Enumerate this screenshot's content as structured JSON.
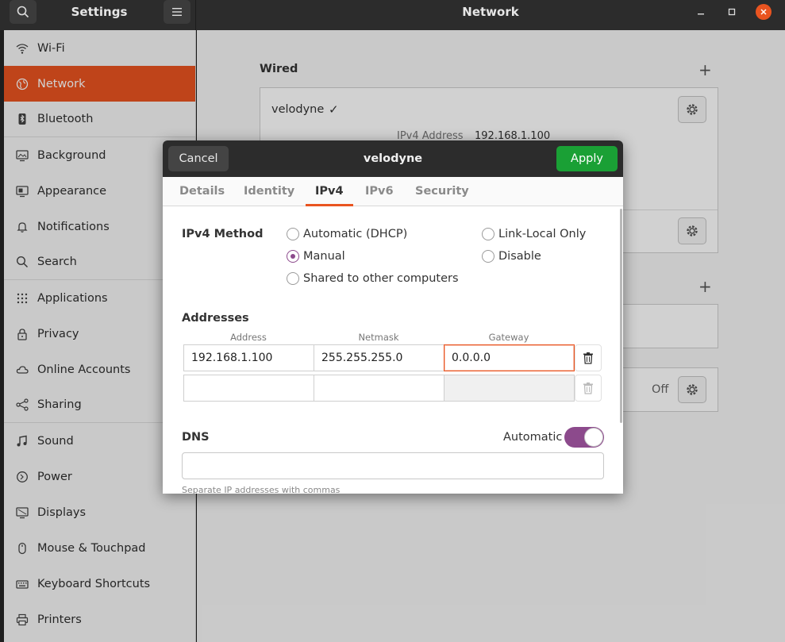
{
  "header": {
    "settings_title": "Settings",
    "window_title": "Network"
  },
  "sidebar": {
    "items": [
      {
        "label": "Wi-Fi",
        "icon": "wifi-icon"
      },
      {
        "label": "Network",
        "icon": "network-icon"
      },
      {
        "label": "Bluetooth",
        "icon": "bluetooth-icon"
      },
      {
        "label": "Background",
        "icon": "background-icon"
      },
      {
        "label": "Appearance",
        "icon": "appearance-icon"
      },
      {
        "label": "Notifications",
        "icon": "bell-icon"
      },
      {
        "label": "Search",
        "icon": "search-icon"
      },
      {
        "label": "Applications",
        "icon": "apps-grid-icon"
      },
      {
        "label": "Privacy",
        "icon": "lock-icon"
      },
      {
        "label": "Online Accounts",
        "icon": "cloud-icon"
      },
      {
        "label": "Sharing",
        "icon": "share-icon"
      },
      {
        "label": "Sound",
        "icon": "music-note-icon"
      },
      {
        "label": "Power",
        "icon": "power-icon"
      },
      {
        "label": "Displays",
        "icon": "display-icon"
      },
      {
        "label": "Mouse & Touchpad",
        "icon": "mouse-icon"
      },
      {
        "label": "Keyboard Shortcuts",
        "icon": "keyboard-icon"
      },
      {
        "label": "Printers",
        "icon": "printer-icon"
      }
    ]
  },
  "main": {
    "wired_label": "Wired",
    "connection_name": "velodyne",
    "ipv4_label": "IPv4 Address",
    "ipv4_value": "192.168.1.100",
    "off_label": "Off"
  },
  "dialog": {
    "title": "velodyne",
    "cancel_label": "Cancel",
    "apply_label": "Apply",
    "tabs": [
      "Details",
      "Identity",
      "IPv4",
      "IPv6",
      "Security"
    ],
    "active_tab": "IPv4",
    "method_label": "IPv4 Method",
    "methods": {
      "dhcp": "Automatic (DHCP)",
      "link_local": "Link-Local Only",
      "manual": "Manual",
      "disable": "Disable",
      "shared": "Shared to other computers"
    },
    "selected_method": "Manual",
    "addresses_label": "Addresses",
    "columns": [
      "Address",
      "Netmask",
      "Gateway"
    ],
    "rows": [
      {
        "address": "192.168.1.100",
        "netmask": "255.255.255.0",
        "gateway": "0.0.0.0"
      },
      {
        "address": "",
        "netmask": "",
        "gateway": ""
      }
    ],
    "dns_label": "DNS",
    "dns_automatic_label": "Automatic",
    "dns_value": "",
    "dns_hint": "Separate IP addresses with commas"
  },
  "colors": {
    "accent": "#e95420",
    "apply_green": "#1aa035",
    "toggle_purple": "#8c4a8c"
  }
}
